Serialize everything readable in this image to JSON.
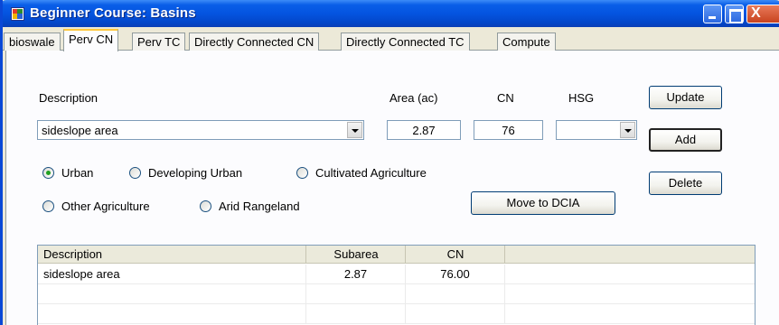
{
  "window": {
    "title": "Beginner Course: Basins",
    "buttons": {
      "minimize": "minimize",
      "maximize": "maximize",
      "close": "X"
    }
  },
  "tabs": [
    {
      "label": "bioswale",
      "active": false
    },
    {
      "label": "Perv CN",
      "active": true
    },
    {
      "label": "Perv TC",
      "active": false
    },
    {
      "label": "Directly Connected CN",
      "active": false
    },
    {
      "label": "Directly Connected TC",
      "active": false
    },
    {
      "label": "Compute",
      "active": false
    }
  ],
  "form": {
    "description_label": "Description",
    "description_value": "sideslope area",
    "area_label": "Area (ac)",
    "area_value": "2.87",
    "cn_label": "CN",
    "cn_value": "76",
    "hsg_label": "HSG",
    "hsg_value": ""
  },
  "radios": [
    {
      "label": "Urban",
      "selected": true
    },
    {
      "label": "Developing Urban",
      "selected": false
    },
    {
      "label": "Cultivated Agriculture",
      "selected": false
    },
    {
      "label": "Other Agriculture",
      "selected": false
    },
    {
      "label": "Arid Rangeland",
      "selected": false
    }
  ],
  "buttons": {
    "update": "Update",
    "add": "Add",
    "delete": "Delete",
    "move_to_dcia": "Move to DCIA"
  },
  "grid": {
    "columns": [
      "Description",
      "Subarea",
      "CN",
      ""
    ],
    "rows": [
      [
        "sideslope area",
        "2.87",
        "76.00",
        ""
      ],
      [
        "",
        "",
        "",
        ""
      ],
      [
        "",
        "",
        "",
        ""
      ]
    ]
  },
  "colors": {
    "titlebar": "#0454e0",
    "window_face": "#ece9d8",
    "active_tab_accent": "#ffc83c",
    "radio_checked": "#21a121"
  }
}
